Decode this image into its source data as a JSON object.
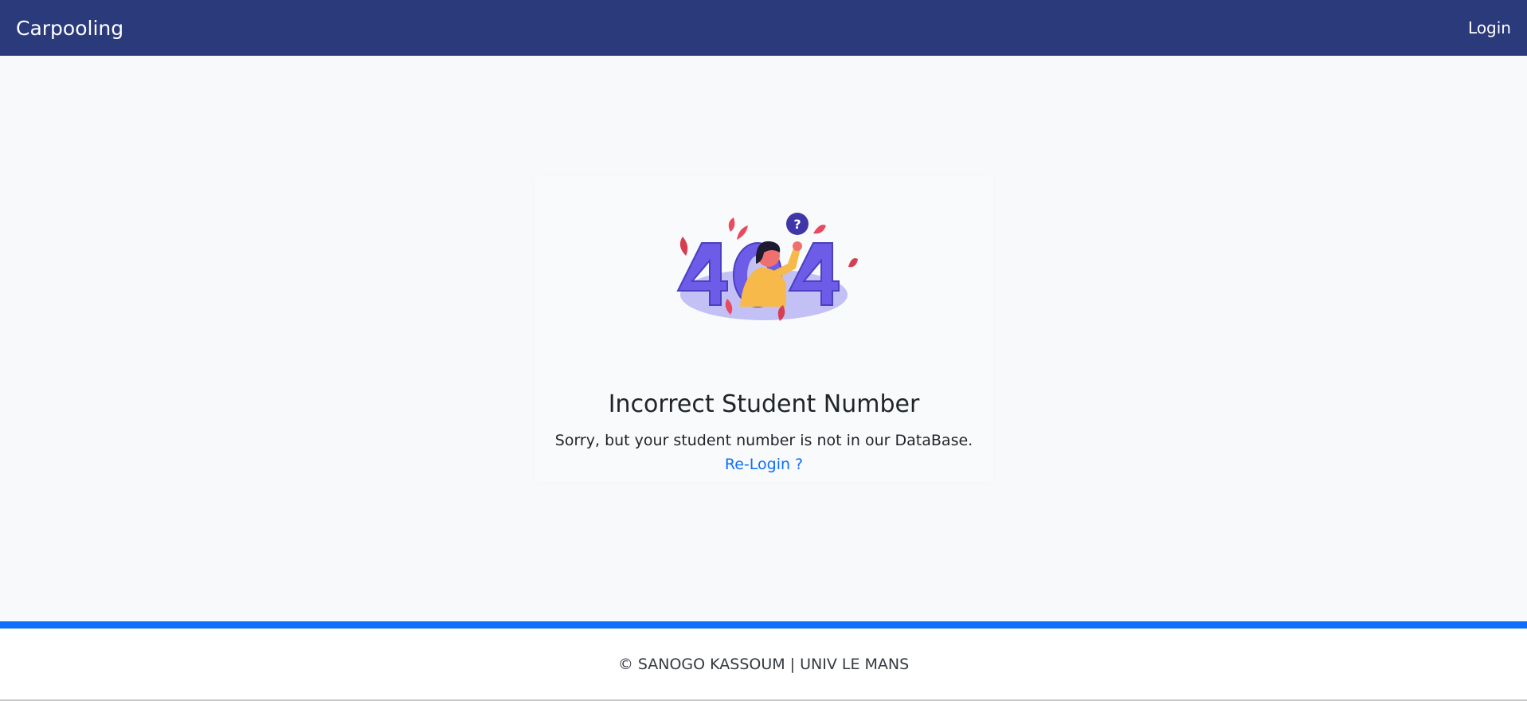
{
  "navbar": {
    "brand": "Carpooling",
    "login_label": "Login"
  },
  "error": {
    "illustration_icon": "404-woman-illustration",
    "title": "Incorrect Student Number",
    "message": "Sorry, but your student number is not in our DataBase.",
    "relogin_link": "Re-Login ?"
  },
  "footer": {
    "text": "© SANOGO KASSOUM | UNIV LE MANS"
  },
  "colors": {
    "navbar": "#2b3a7b",
    "accent": "#0d6efd",
    "illustration_purple": "#6c5ce7"
  }
}
